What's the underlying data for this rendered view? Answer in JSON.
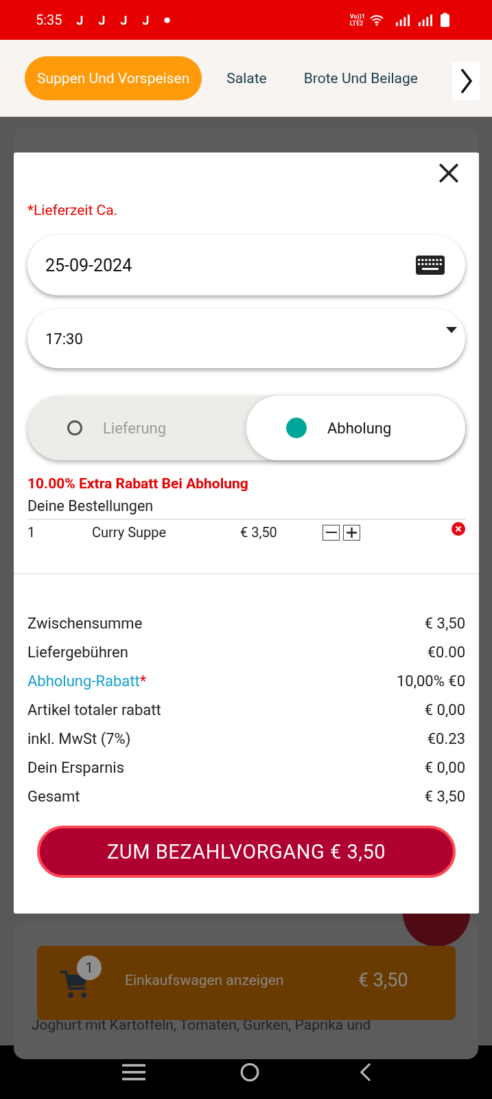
{
  "status_bar": {
    "time": "5:35",
    "network": [
      "Vo))1",
      "LTE2"
    ]
  },
  "category_tabs": [
    {
      "label": "Suppen Und Vorspeisen",
      "selected": true
    },
    {
      "label": "Salate",
      "selected": false
    },
    {
      "label": "Brote Und Beilage",
      "selected": false
    }
  ],
  "modal": {
    "time_label": "*Lieferzeit Ca.",
    "date": "25-09-2024",
    "time": "17:30",
    "modes": [
      {
        "label": "Lieferung",
        "selected": false
      },
      {
        "label": "Abholung",
        "selected": true
      }
    ],
    "discount_note": "10.00% Extra Rabatt Bei Abholung",
    "orders_heading": "Deine Bestellungen",
    "order_items": [
      {
        "quantity": "1",
        "name": "Curry Suppe",
        "price": "€ 3,50"
      }
    ],
    "summary": [
      {
        "label": "Zwischensumme",
        "value": "€ 3,50",
        "highlight": false
      },
      {
        "label": "Liefergebühren",
        "value": "€0.00",
        "highlight": false
      },
      {
        "label": "Abholung-Rabatt",
        "mark": "*",
        "value": "10,00% €0",
        "highlight": true
      },
      {
        "label": "Artikel totaler rabatt",
        "value": "€ 0,00",
        "highlight": false
      },
      {
        "label": "inkl. MwSt (7%)",
        "value": "€0.23",
        "highlight": false
      },
      {
        "label": "Dein Ersparnis",
        "value": "€ 0,00",
        "highlight": false
      },
      {
        "label": "Gesamt",
        "value": "€ 3,50",
        "highlight": false
      }
    ],
    "checkout_button": "ZUM BEZAHLVORGANG € 3,50"
  },
  "cart_bar": {
    "count": "1",
    "label": "Einkaufswagen anzeigen",
    "total": "€ 3,50"
  },
  "background_text": "Joghurt mit Kartoffeln, Tomaten, Gurken, Paprika und"
}
